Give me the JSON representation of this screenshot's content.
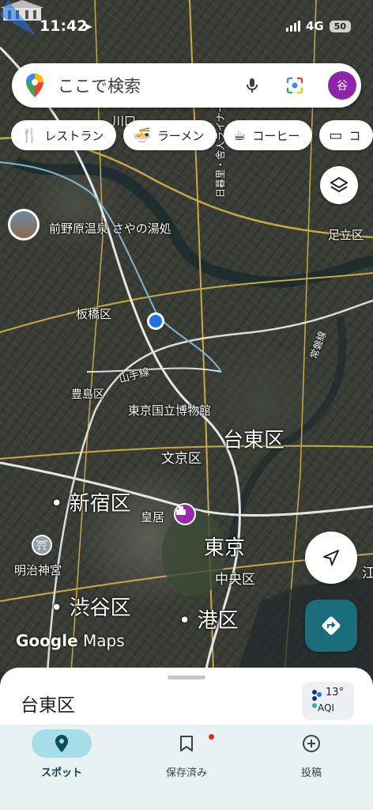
{
  "status": {
    "time": "11:42",
    "network": "4G",
    "battery": "50"
  },
  "search": {
    "placeholder": "ここで検索",
    "avatar_initial": "谷"
  },
  "chips": [
    {
      "label": "レストラン",
      "icon": "restaurant-icon"
    },
    {
      "label": "ラーメン",
      "icon": "ramen-icon"
    },
    {
      "label": "コーヒー",
      "icon": "coffee-icon"
    },
    {
      "label": "コ",
      "icon": "store-icon"
    }
  ],
  "map_labels": {
    "onsen": "前野原温泉 さやの湯処",
    "adachi": "足立区",
    "itabashi": "板橋区",
    "toshima": "豊島区",
    "museum": "東京国立博物館",
    "taito": "台東区",
    "bunkyo": "文京区",
    "shinjuku": "新宿区",
    "kokyo": "皇居",
    "tokyo": "東京",
    "meiji": "明治神宮",
    "chuo": "中央区",
    "shibuya": "渋谷区",
    "minato": "港区",
    "yamanote": "山手線",
    "nippori": "日暮里・舎人ライナー",
    "keihin": "常磐線",
    "koto": "江",
    "kawa": "川口"
  },
  "branding": {
    "google": "Google",
    "maps": "Maps"
  },
  "sheet": {
    "place": "台東区",
    "temp": "13°",
    "aqi": "AQI"
  },
  "nav": [
    {
      "label": "スポット",
      "icon": "place-pin-icon",
      "active": true
    },
    {
      "label": "保存済み",
      "icon": "bookmark-icon",
      "active": false
    },
    {
      "label": "投稿",
      "icon": "add-circle-icon",
      "active": false
    }
  ],
  "colors": {
    "accent": "#1a73e8",
    "teal": "#1a6d7a",
    "avatar": "#8e24aa",
    "active_pill": "#a7dde8"
  }
}
